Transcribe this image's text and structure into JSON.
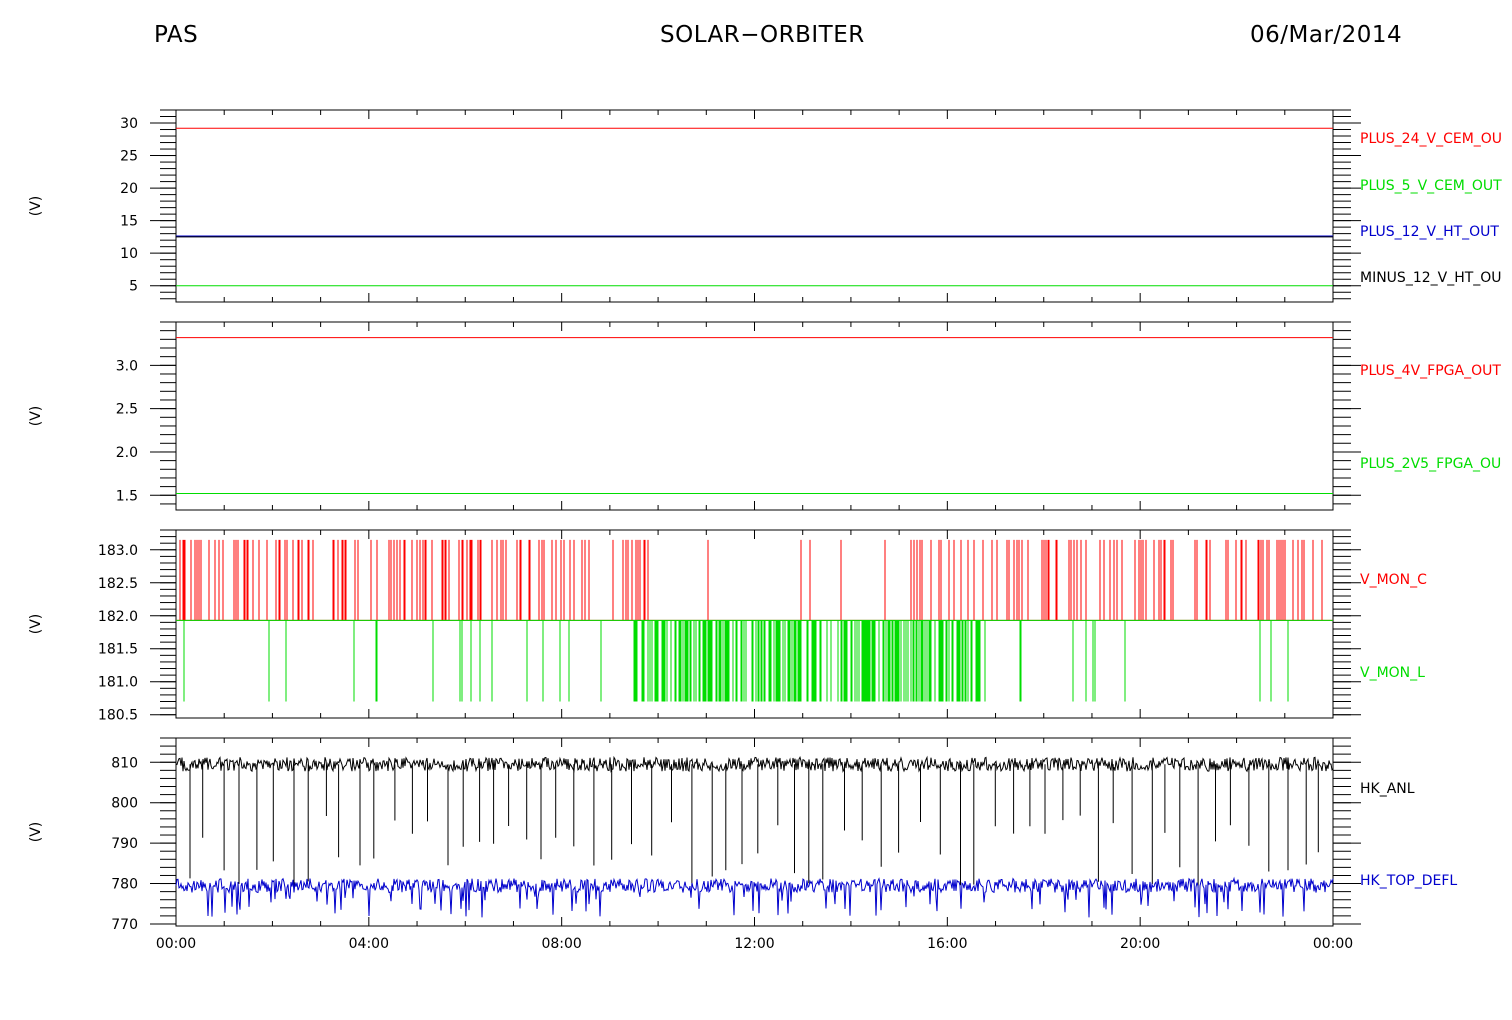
{
  "header": {
    "left": "PAS",
    "center": "SOLAR−ORBITER",
    "right": "06/Mar/2014"
  },
  "chart_data": [
    {
      "type": "line",
      "ylabel": "(V)",
      "ylim": [
        2.5,
        32
      ],
      "yticks": [
        5,
        10,
        15,
        20,
        25,
        30
      ],
      "ytick_labels": [
        "5",
        "10",
        "15",
        "20",
        "25",
        "30"
      ],
      "x": [
        "00:00",
        "24:00"
      ],
      "series": [
        {
          "name": "PLUS_24_V_CEM_OU",
          "color": "#ff0000",
          "values": [
            29.2,
            29.2
          ]
        },
        {
          "name": "PLUS_5_V_CEM_OUT",
          "color": "#00dd00",
          "values": [
            5.0,
            5.0
          ]
        },
        {
          "name": "PLUS_12_V_HT_OUT",
          "color": "#0000cc",
          "values": [
            12.6,
            12.6
          ]
        },
        {
          "name": "MINUS_12_V_HT_OU",
          "color": "#000000",
          "values": [
            12.5,
            12.5
          ]
        }
      ]
    },
    {
      "type": "line",
      "ylabel": "(V)",
      "ylim": [
        1.33,
        3.5
      ],
      "yticks": [
        1.5,
        2.0,
        2.5,
        3.0
      ],
      "ytick_labels": [
        "1.5",
        "2.0",
        "2.5",
        "3.0"
      ],
      "x": [
        "00:00",
        "24:00"
      ],
      "series": [
        {
          "name": "PLUS_4V_FPGA_OUT",
          "color": "#ff0000",
          "values": [
            3.32,
            3.32
          ]
        },
        {
          "name": "PLUS_2V5_FPGA_OU",
          "color": "#00dd00",
          "values": [
            1.52,
            1.52
          ]
        }
      ]
    },
    {
      "type": "line",
      "ylabel": "(V)",
      "ylim": [
        180.45,
        183.3
      ],
      "yticks": [
        180.5,
        181.0,
        181.5,
        182.0,
        182.5,
        183.0
      ],
      "ytick_labels": [
        "180.5",
        "181.0",
        "181.5",
        "182.0",
        "182.5",
        "183.0"
      ],
      "x": [
        "00:00",
        "24:00"
      ],
      "series": [
        {
          "name": "V_MON_C",
          "color": "#ff0000",
          "baseline": 181.93,
          "spike_to": 183.15
        },
        {
          "name": "V_MON_L",
          "color": "#00dd00",
          "baseline": 181.93,
          "spike_to": 180.7
        }
      ]
    },
    {
      "type": "line",
      "ylabel": "(V)",
      "ylim": [
        769.5,
        816
      ],
      "yticks": [
        770,
        780,
        790,
        800,
        810
      ],
      "ytick_labels": [
        "770",
        "780",
        "790",
        "800",
        "810"
      ],
      "x": [
        "00:00",
        "24:00"
      ],
      "series": [
        {
          "name": "HK_ANL",
          "color": "#000000",
          "baseline": 809.5,
          "spike_to": 779
        },
        {
          "name": "HK_TOP_DEFL",
          "color": "#0000cc",
          "baseline": 779.5
        }
      ]
    }
  ],
  "x_axis": {
    "tick_labels": [
      "00:00",
      "04:00",
      "08:00",
      "12:00",
      "16:00",
      "20:00",
      "00:00"
    ]
  }
}
